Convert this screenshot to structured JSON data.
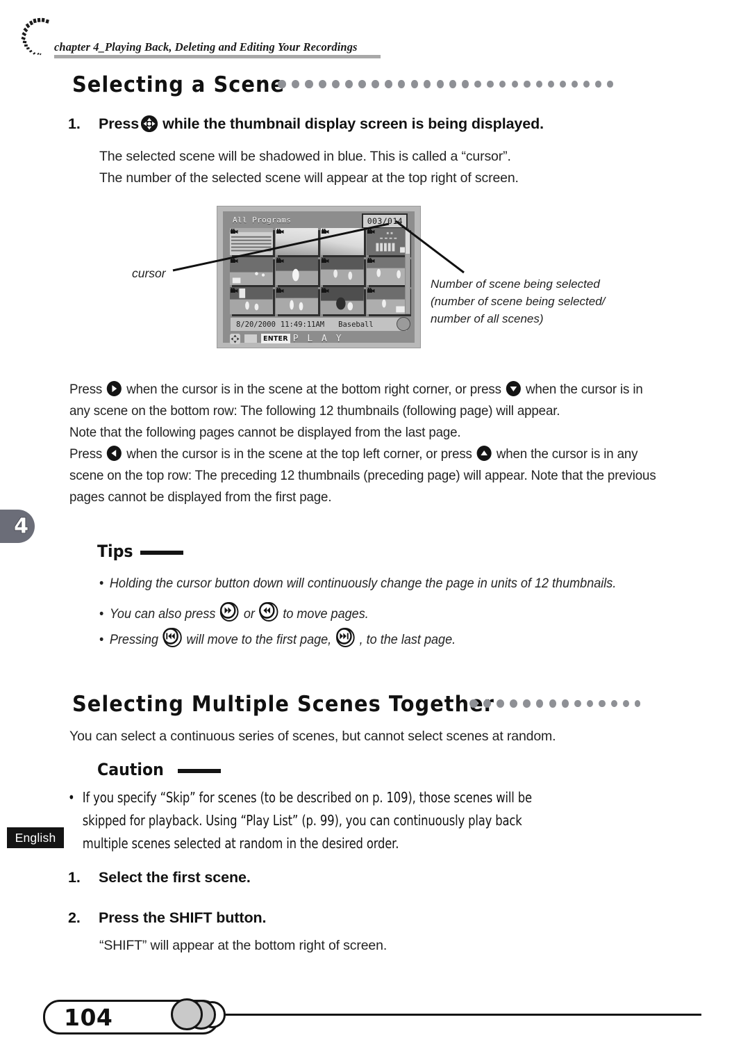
{
  "header": {
    "chapter_breadcrumb": "chapter 4_Playing Back, Deleting and Editing Your Recordings",
    "spiral_icon": "spiral-arc-decoration"
  },
  "section1": {
    "heading": "Selecting a Scene",
    "dot_count": 27,
    "step1": {
      "number": "1.",
      "text_before_icon": "Press",
      "icon": "dpad-button-icon",
      "text_after_icon": "while the thumbnail display screen is being displayed."
    },
    "step1_body": [
      "The selected scene will be shadowed in blue. This is called a “cursor”.",
      "The number of the selected scene will appear at the top right of screen."
    ]
  },
  "lcd": {
    "title": "All Programs",
    "counter": "003/014",
    "thumbnail_rows": 3,
    "thumbnail_cols": 4,
    "info_date": "8/20/2000",
    "info_time": "11:49:11AM",
    "info_label": "Baseball",
    "enter_badge": "ENTER",
    "play_label": "P L A Y",
    "dpad_icon": "dpad-icon",
    "camera_icon": "camera-icon",
    "badge_icon": "clock-badge-icon"
  },
  "callouts": {
    "cursor_label": "cursor",
    "number_label_lines": [
      "Number of scene being selected",
      "(number of scene being selected/",
      "number of all scenes)"
    ]
  },
  "paragraphs": {
    "p1_a": "Press",
    "p1_icon_a": "right-arrow-button-icon",
    "p1_b": "when the cursor is in the scene at the bottom right corner, or press",
    "p1_icon_b": "down-arrow-button-icon",
    "p1_c": "when the cursor is in any scene on the bottom row: The following 12 thumbnails (following page) will appear.",
    "p2": "Note that the following pages cannot be displayed from the last page.",
    "p3_a": "Press",
    "p3_icon_a": "left-arrow-button-icon",
    "p3_b": "when the cursor is in the scene at the top left corner, or press",
    "p3_icon_b": "up-arrow-button-icon",
    "p3_c": "when the cursor is in any scene on the top row: The preceding 12 thumbnails (preceding page) will appear. Note that the previous pages cannot be displayed from the first page."
  },
  "tips": {
    "heading": "Tips",
    "items": [
      {
        "bullet": "•",
        "text": "Holding the cursor button down will continuously change the page in units of 12 thumbnails."
      },
      {
        "bullet": "•",
        "text_a": "You can also press",
        "icon_a": "fast-forward-icon",
        "text_b": "or",
        "icon_b": "rewind-icon",
        "text_c": "to move pages."
      },
      {
        "bullet": "•",
        "text_a": "Pressing",
        "icon_a": "skip-to-start-icon",
        "text_b": "will move to the first page,",
        "icon_b": "skip-to-end-icon",
        "text_c": ", to the last page."
      }
    ]
  },
  "section2": {
    "heading": "Selecting Multiple Scenes Together",
    "dot_count": 14,
    "intro": "You can select a continuous series of scenes, but cannot select scenes at random.",
    "caution": {
      "heading": "Caution",
      "bullet": "•",
      "text": "If you specify “Skip” for scenes (to be described on p. 109), those scenes will be skipped for playback. Using “Play List” (p. 99), you can continuously play back multiple scenes selected at random in the desired order."
    },
    "step1": {
      "number": "1.",
      "text": "Select the first scene."
    },
    "step2": {
      "number": "2.",
      "text": "Press the SHIFT button."
    },
    "step2_body": "“SHIFT” will appear at the bottom right of screen."
  },
  "margin": {
    "chapter_tab": "4",
    "language_tag": "English"
  },
  "footer": {
    "page_number": "104"
  }
}
